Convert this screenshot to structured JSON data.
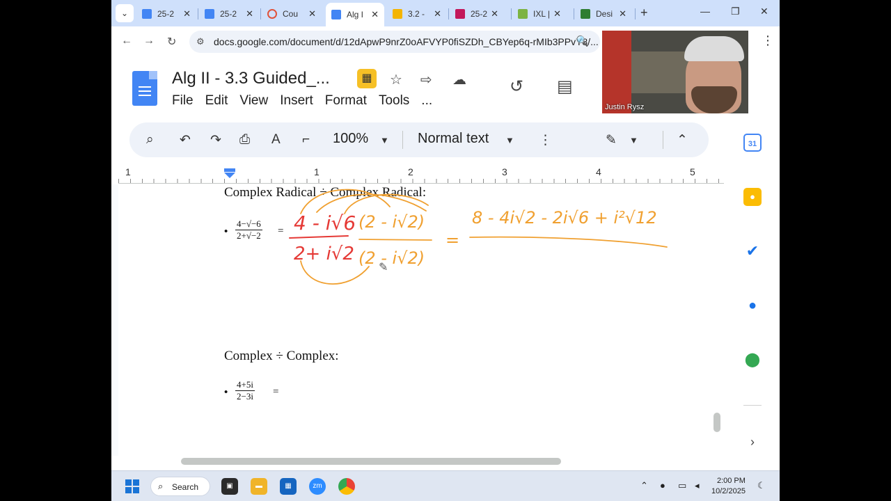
{
  "browser": {
    "tabs": [
      {
        "label": "25-2",
        "icon_color": "#4285f4"
      },
      {
        "label": "25-2",
        "icon_color": "#4285f4"
      },
      {
        "label": "Cou",
        "icon_color": "#e0523a"
      },
      {
        "label": "Alg I",
        "icon_color": "#4285f4",
        "active": true
      },
      {
        "label": "3.2 -",
        "icon_color": "#f4b400"
      },
      {
        "label": "25-2",
        "icon_color": "#c2185b"
      },
      {
        "label": "IXL |",
        "icon_color": "#7cb342"
      },
      {
        "label": "Desi",
        "icon_color": "#2e7d32"
      }
    ],
    "url": "docs.google.com/document/d/12dApwP9nrZ0oAFVYP0fiSZDh_CBYep6q-rMIb3PPvY8/..."
  },
  "doc": {
    "title": "Alg II - 3.3 Guided_...",
    "menu": [
      "File",
      "Edit",
      "View",
      "Insert",
      "Format",
      "Tools",
      "..."
    ],
    "toolbar": {
      "zoom": "100%",
      "style": "Normal text"
    },
    "ruler_numbers": [
      "1",
      "1",
      "2",
      "3",
      "4",
      "5"
    ],
    "sections": [
      {
        "heading": "Complex Radical ÷ Complex Radical:",
        "expr": {
          "numerator": "4−√−6",
          "denominator": "2+√−2",
          "equals": "="
        }
      },
      {
        "heading": "Complex ÷ Complex:",
        "expr": {
          "numerator": "4+5i",
          "denominator": "2−3i",
          "equals": "="
        }
      }
    ],
    "handwriting": {
      "red_numerator": "4 - i√6",
      "red_denominator": "2+ i√2",
      "orange_factor_top": "(2 - i√2)",
      "orange_factor_bottom": "(2 - i√2)",
      "equals": "=",
      "orange_result": "8 - 4i√2 - 2i√6 + i²√12",
      "colors": {
        "red": "#e53935",
        "orange": "#f0a030"
      }
    }
  },
  "video": {
    "participant_name": "Justin Rysz"
  },
  "taskbar": {
    "search_label": "Search",
    "time": "2:00 PM",
    "date": "10/2/2025"
  }
}
